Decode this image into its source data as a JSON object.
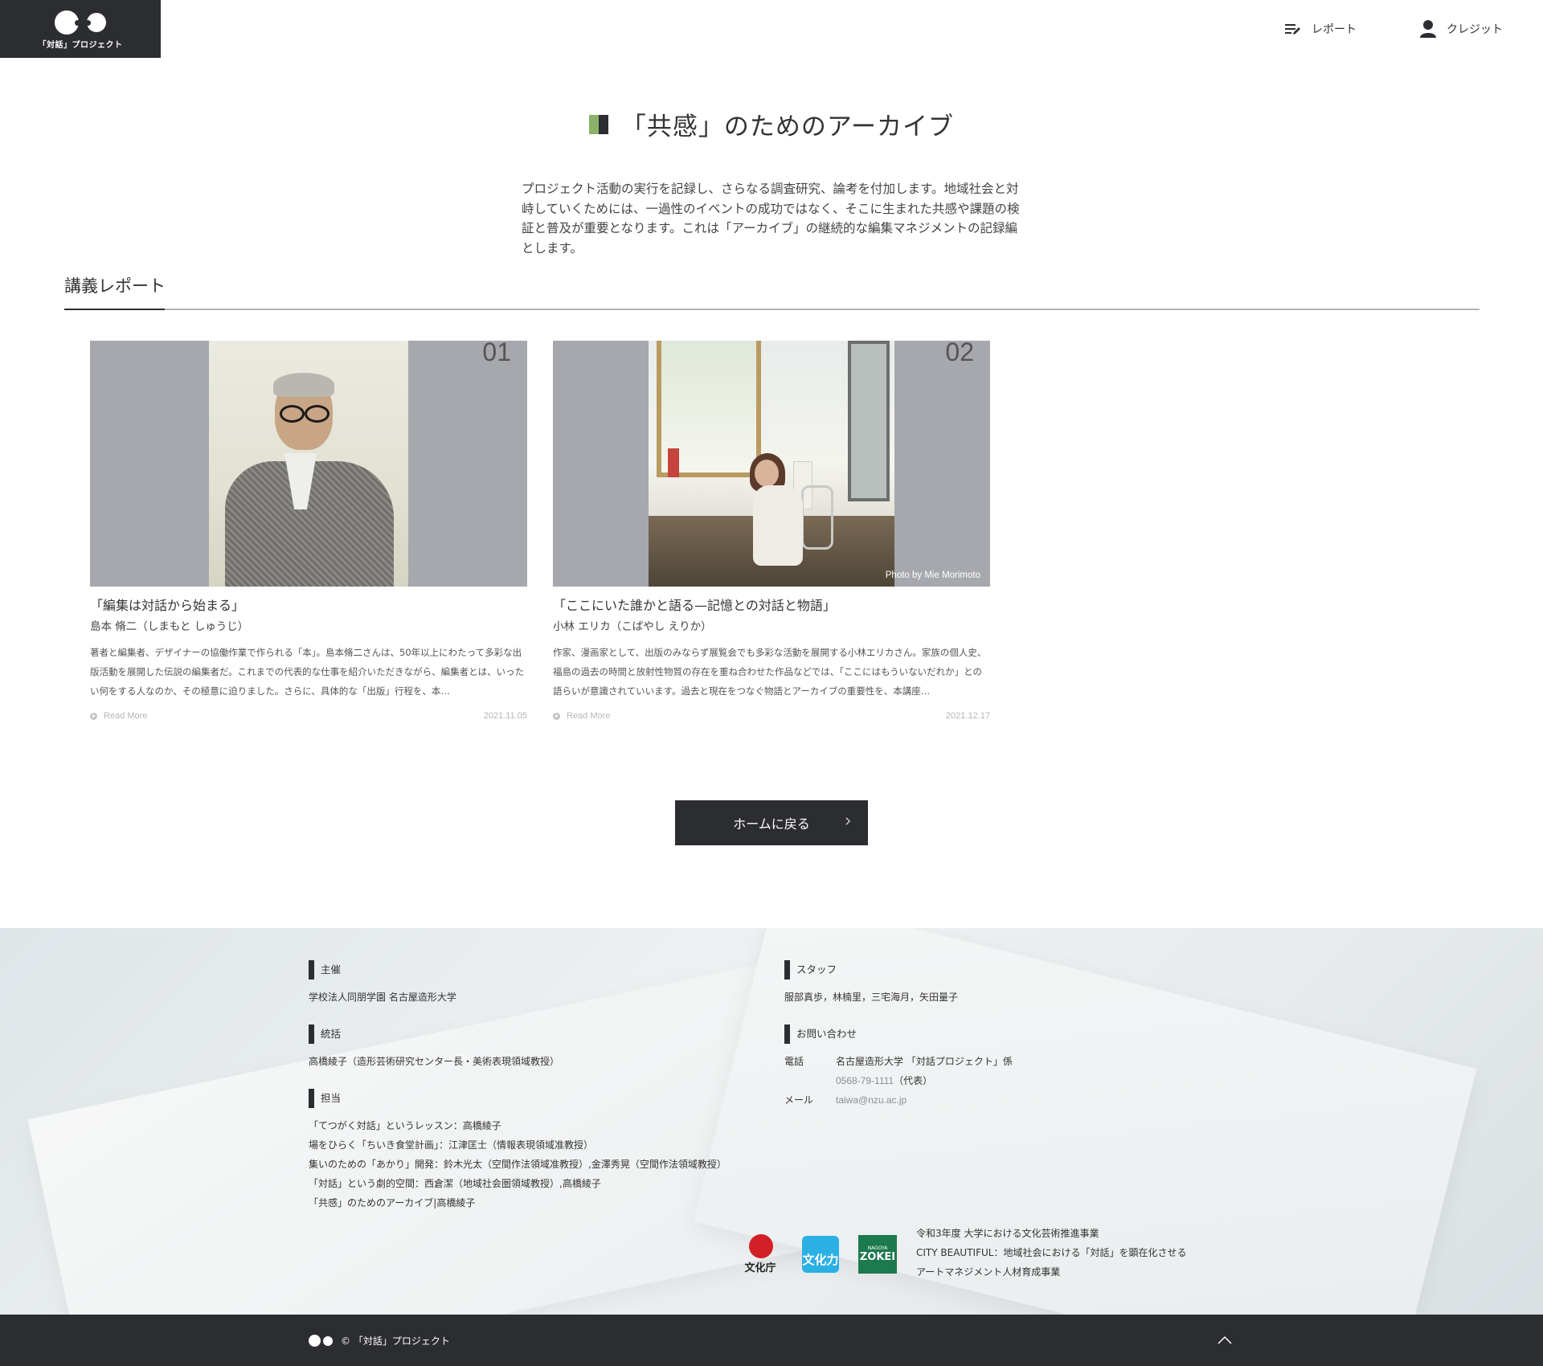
{
  "header": {
    "logo_text": "「対話」プロジェクト",
    "nav": [
      {
        "label": "レポート",
        "icon": "report-edit-icon"
      },
      {
        "label": "クレジット",
        "icon": "person-icon"
      }
    ]
  },
  "page": {
    "title": "「共感」のためのアーカイブ",
    "intro": "プロジェクト活動の実行を記録し、さらなる調査研究、論考を付加します。地域社会と対峙していくためには、一過性のイベントの成功ではなく、そこに生まれた共感や課題の検証と普及が重要となります。これは「アーカイブ」の継続的な編集マネジメントの記録編とします。",
    "section_title": "講義レポート"
  },
  "cards": [
    {
      "number": "01",
      "title": "「編集は対話から始まる」",
      "author": "島本 脩二（しまもと しゅうじ）",
      "description": "著者と編集者、デザイナーの協働作業で作られる「本」。島本脩二さんは、50年以上にわたって多彩な出版活動を展開した伝説の編集者だ。これまでの代表的な仕事を紹介いただきながら、編集者とは、いったい何をする人なのか、その極意に迫りました。さらに、具体的な「出版」行程を、本…",
      "read_more": "Read More",
      "date": "2021.11.05",
      "photo_credit": ""
    },
    {
      "number": "02",
      "title": "「ここにいた誰かと語る—記憶との対話と物語」",
      "author": "小林 エリカ（こばやし えりか）",
      "description": "作家、漫画家として、出版のみならず展覧会でも多彩な活動を展開する小林エリカさん。家族の個人史、福島の過去の時間と放射性物質の存在を重ね合わせた作品などでは、「ここにはもういないだれか」との語らいが意識されていいます。過去と現在をつなぐ物語とアーカイブの重要性を、本講座…",
      "read_more": "Read More",
      "date": "2021.12.17",
      "photo_credit": "Photo by Mie Morimoto"
    }
  ],
  "home_button": "ホームに戻る",
  "footer": {
    "host": {
      "heading": "主催",
      "text": "学校法人同朋学園 名古屋造形大学"
    },
    "director": {
      "heading": "統括",
      "text": "高橋綾子（造形芸術研究センター長・美術表現領域教授）"
    },
    "charge": {
      "heading": "担当",
      "lines": [
        "「てつがく対話」というレッスン：高橋綾子",
        "場をひらく「ちいき食堂計画」：江津匡士（情報表現領域准教授）",
        "集いのための「あかり」開発：鈴木光太（空間作法領域准教授）,金澤秀晃（空間作法領域教授）",
        "「対話」という劇的空間：西倉潔（地域社会圏領域教授）,高橋綾子",
        "「共感」のためのアーカイブ|高橋綾子"
      ]
    },
    "staff": {
      "heading": "スタッフ",
      "text": "服部真歩，林楠里，三宅海月，矢田量子"
    },
    "contact": {
      "heading": "お問い合わせ",
      "phone_label": "電話",
      "phone_org": "名古屋造形大学 「対話プロジェクト」係",
      "phone_number": "0568-79-1111",
      "phone_suffix": "（代表）",
      "mail_label": "メール",
      "mail": "taiwa@nzu.ac.jp"
    },
    "logos": {
      "bunka": "文化庁",
      "bunkaryoku": "文化力",
      "nagoya_top": "NAGOYA",
      "nagoya_main": "ZOKEI"
    },
    "program": [
      "令和3年度 大学における文化芸術推進事業",
      "CITY BEAUTIFUL：地域社会における「対話」を顕在化させる",
      "アートマネジメント人材育成事業"
    ],
    "copyright": "© 「対話」プロジェクト"
  },
  "colors": {
    "dark": "#2c2d31",
    "accent_green": "#8cb26a",
    "footer_bg": "#e7ebed"
  }
}
